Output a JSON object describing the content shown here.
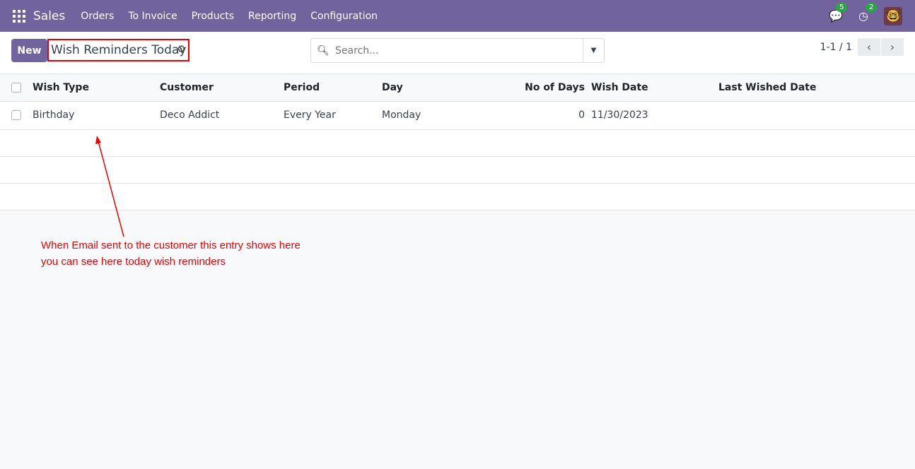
{
  "nav": {
    "brand": "Sales",
    "menu": [
      "Orders",
      "To Invoice",
      "Products",
      "Reporting",
      "Configuration"
    ],
    "messages_count": "5",
    "activities_count": "2"
  },
  "control": {
    "new_label": "New",
    "title": "Wish Reminders Today",
    "search_placeholder": "Search...",
    "pager": "1-1 / 1"
  },
  "table": {
    "headers": [
      "Wish Type",
      "Customer",
      "Period",
      "Day",
      "No of Days",
      "Wish Date",
      "Last Wished Date"
    ],
    "rows": [
      [
        "Birthday",
        "Deco Addict",
        "Every Year",
        "Monday",
        "0",
        "11/30/2023",
        ""
      ]
    ]
  },
  "annotation": {
    "line1": "When Email sent to the customer this entry shows here",
    "line2": "you can see here today wish reminders",
    "color": "#ee0000"
  }
}
